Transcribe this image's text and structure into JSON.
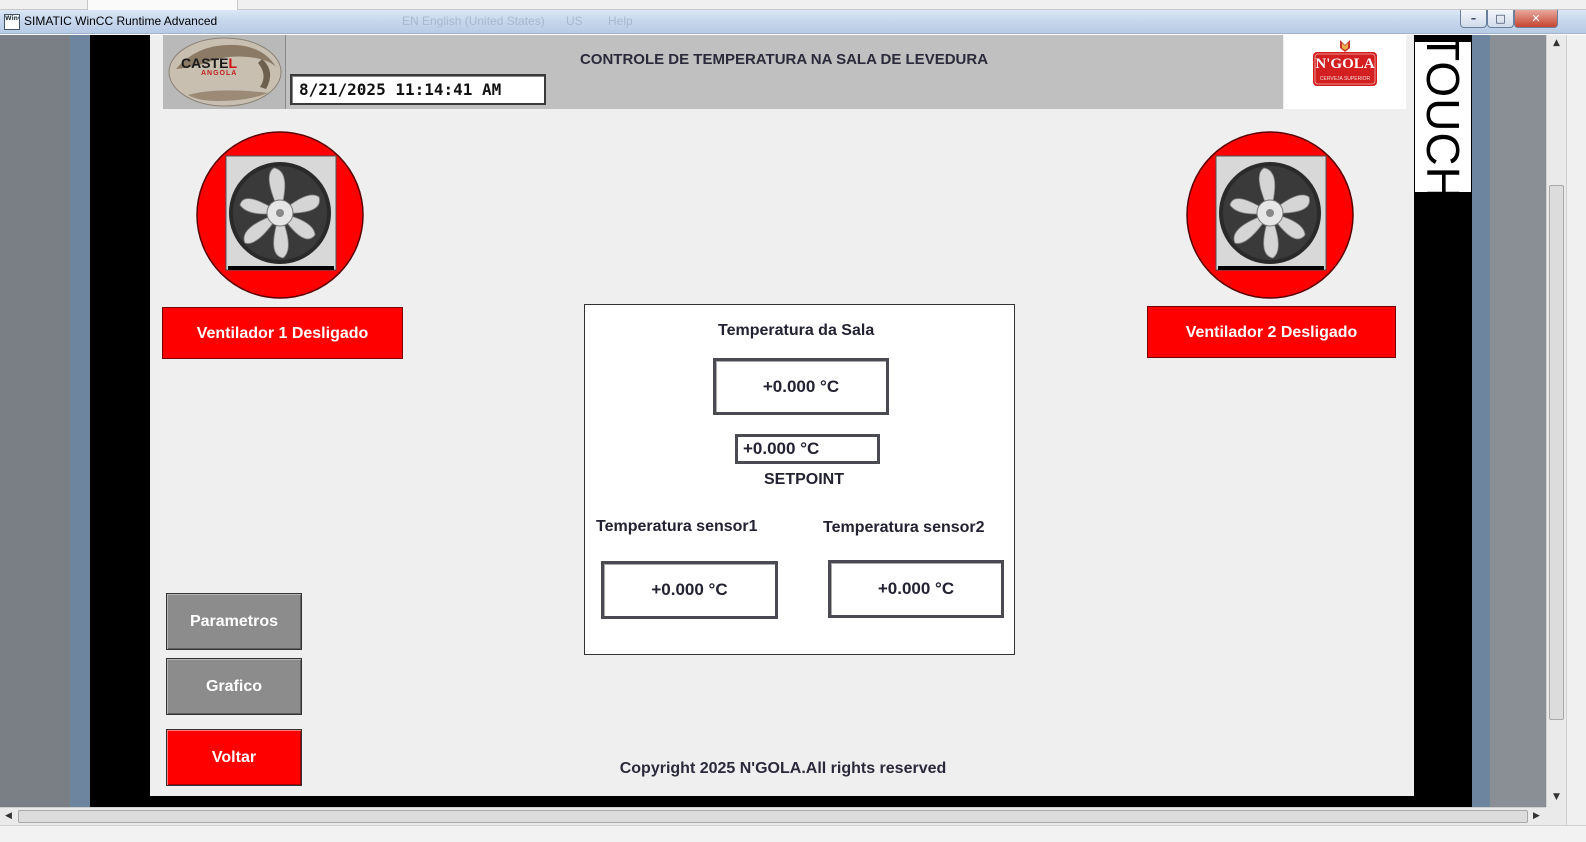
{
  "window": {
    "icon_text": "WinCC",
    "title": "SIMATIC WinCC Runtime Advanced",
    "ghost_items": [
      "EN English (United States)",
      "US",
      "Help"
    ],
    "controls": {
      "minimize": "–",
      "maximize": "□",
      "close": "✕"
    }
  },
  "header": {
    "title": "CONTROLE DE TEMPERATURA NA SALA DE LEVEDURA",
    "datetime": "8/21/2025 11:14:41 AM",
    "left_logo": {
      "brand": "CASTE",
      "brand_accent": "L",
      "sub": "ANGOLA"
    },
    "right_logo": {
      "brand": "N'GOLA",
      "sub": "CERVEJA SUPERIOR"
    }
  },
  "side_label": "TOUCH",
  "fans": [
    {
      "status": "Ventilador 1 Desligado"
    },
    {
      "status": "Ventilador 2 Desligado"
    }
  ],
  "panel": {
    "room_temp_label": "Temperatura da Sala",
    "room_temp_value": "+0.000  °C",
    "setpoint_value": "+0.000  °C",
    "setpoint_label": "SETPOINT",
    "sensor1_label": "Temperatura sensor1",
    "sensor1_value": "+0.000  °C",
    "sensor2_label": "Temperatura sensor2",
    "sensor2_value": "+0.000  °C"
  },
  "buttons": {
    "parametros": "Parametros",
    "grafico": "Grafico",
    "voltar": "Voltar"
  },
  "footer": {
    "copyright": "Copyright 2025 N'GOLA.All rights reserved"
  },
  "colors": {
    "alarm_red": "#ff0000",
    "hmi_background": "#efefef",
    "header_gray": "#c0c0c0",
    "button_gray": "#8c8c8c"
  }
}
